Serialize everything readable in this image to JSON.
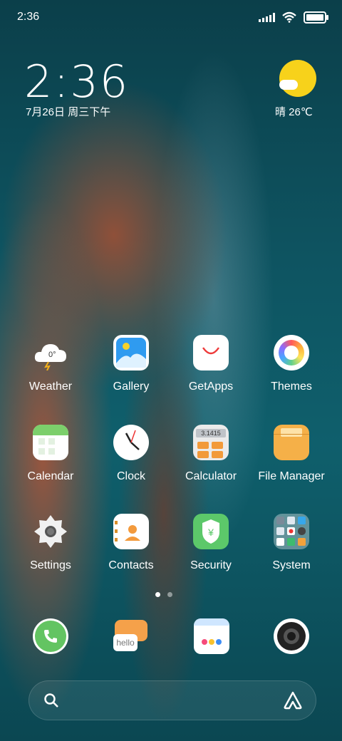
{
  "status_bar": {
    "time": "2:36"
  },
  "lock_widget": {
    "time": "2:36",
    "date": "7月26日 周三下午",
    "weather": "晴 26℃"
  },
  "apps": [
    {
      "label": "Weather",
      "temp": "0°"
    },
    {
      "label": "Gallery"
    },
    {
      "label": "GetApps"
    },
    {
      "label": "Themes"
    },
    {
      "label": "Calendar"
    },
    {
      "label": "Clock"
    },
    {
      "label": "Calculator",
      "display": "3.1415"
    },
    {
      "label": "File Manager"
    },
    {
      "label": "Settings"
    },
    {
      "label": "Contacts"
    },
    {
      "label": "Security",
      "symbol": "¥"
    },
    {
      "label": "System"
    }
  ],
  "dock": {
    "messaging_text": "hello"
  },
  "page_indicator": {
    "pages": 2,
    "current": 1
  }
}
